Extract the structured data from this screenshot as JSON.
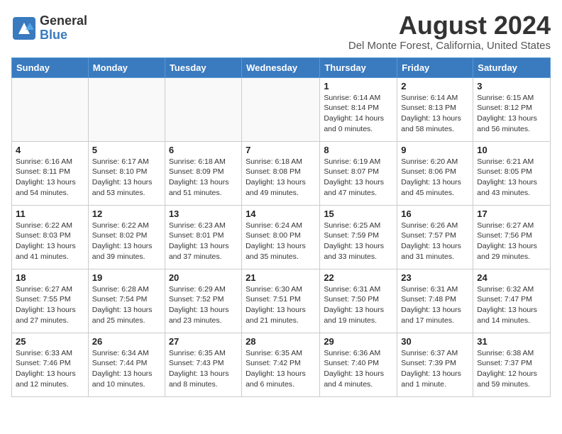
{
  "header": {
    "logo_general": "General",
    "logo_blue": "Blue",
    "month_year": "August 2024",
    "location": "Del Monte Forest, California, United States"
  },
  "days_of_week": [
    "Sunday",
    "Monday",
    "Tuesday",
    "Wednesday",
    "Thursday",
    "Friday",
    "Saturday"
  ],
  "weeks": [
    [
      {
        "day": "",
        "info": ""
      },
      {
        "day": "",
        "info": ""
      },
      {
        "day": "",
        "info": ""
      },
      {
        "day": "",
        "info": ""
      },
      {
        "day": "1",
        "info": "Sunrise: 6:14 AM\nSunset: 8:14 PM\nDaylight: 14 hours\nand 0 minutes."
      },
      {
        "day": "2",
        "info": "Sunrise: 6:14 AM\nSunset: 8:13 PM\nDaylight: 13 hours\nand 58 minutes."
      },
      {
        "day": "3",
        "info": "Sunrise: 6:15 AM\nSunset: 8:12 PM\nDaylight: 13 hours\nand 56 minutes."
      }
    ],
    [
      {
        "day": "4",
        "info": "Sunrise: 6:16 AM\nSunset: 8:11 PM\nDaylight: 13 hours\nand 54 minutes."
      },
      {
        "day": "5",
        "info": "Sunrise: 6:17 AM\nSunset: 8:10 PM\nDaylight: 13 hours\nand 53 minutes."
      },
      {
        "day": "6",
        "info": "Sunrise: 6:18 AM\nSunset: 8:09 PM\nDaylight: 13 hours\nand 51 minutes."
      },
      {
        "day": "7",
        "info": "Sunrise: 6:18 AM\nSunset: 8:08 PM\nDaylight: 13 hours\nand 49 minutes."
      },
      {
        "day": "8",
        "info": "Sunrise: 6:19 AM\nSunset: 8:07 PM\nDaylight: 13 hours\nand 47 minutes."
      },
      {
        "day": "9",
        "info": "Sunrise: 6:20 AM\nSunset: 8:06 PM\nDaylight: 13 hours\nand 45 minutes."
      },
      {
        "day": "10",
        "info": "Sunrise: 6:21 AM\nSunset: 8:05 PM\nDaylight: 13 hours\nand 43 minutes."
      }
    ],
    [
      {
        "day": "11",
        "info": "Sunrise: 6:22 AM\nSunset: 8:03 PM\nDaylight: 13 hours\nand 41 minutes."
      },
      {
        "day": "12",
        "info": "Sunrise: 6:22 AM\nSunset: 8:02 PM\nDaylight: 13 hours\nand 39 minutes."
      },
      {
        "day": "13",
        "info": "Sunrise: 6:23 AM\nSunset: 8:01 PM\nDaylight: 13 hours\nand 37 minutes."
      },
      {
        "day": "14",
        "info": "Sunrise: 6:24 AM\nSunset: 8:00 PM\nDaylight: 13 hours\nand 35 minutes."
      },
      {
        "day": "15",
        "info": "Sunrise: 6:25 AM\nSunset: 7:59 PM\nDaylight: 13 hours\nand 33 minutes."
      },
      {
        "day": "16",
        "info": "Sunrise: 6:26 AM\nSunset: 7:57 PM\nDaylight: 13 hours\nand 31 minutes."
      },
      {
        "day": "17",
        "info": "Sunrise: 6:27 AM\nSunset: 7:56 PM\nDaylight: 13 hours\nand 29 minutes."
      }
    ],
    [
      {
        "day": "18",
        "info": "Sunrise: 6:27 AM\nSunset: 7:55 PM\nDaylight: 13 hours\nand 27 minutes."
      },
      {
        "day": "19",
        "info": "Sunrise: 6:28 AM\nSunset: 7:54 PM\nDaylight: 13 hours\nand 25 minutes."
      },
      {
        "day": "20",
        "info": "Sunrise: 6:29 AM\nSunset: 7:52 PM\nDaylight: 13 hours\nand 23 minutes."
      },
      {
        "day": "21",
        "info": "Sunrise: 6:30 AM\nSunset: 7:51 PM\nDaylight: 13 hours\nand 21 minutes."
      },
      {
        "day": "22",
        "info": "Sunrise: 6:31 AM\nSunset: 7:50 PM\nDaylight: 13 hours\nand 19 minutes."
      },
      {
        "day": "23",
        "info": "Sunrise: 6:31 AM\nSunset: 7:48 PM\nDaylight: 13 hours\nand 17 minutes."
      },
      {
        "day": "24",
        "info": "Sunrise: 6:32 AM\nSunset: 7:47 PM\nDaylight: 13 hours\nand 14 minutes."
      }
    ],
    [
      {
        "day": "25",
        "info": "Sunrise: 6:33 AM\nSunset: 7:46 PM\nDaylight: 13 hours\nand 12 minutes."
      },
      {
        "day": "26",
        "info": "Sunrise: 6:34 AM\nSunset: 7:44 PM\nDaylight: 13 hours\nand 10 minutes."
      },
      {
        "day": "27",
        "info": "Sunrise: 6:35 AM\nSunset: 7:43 PM\nDaylight: 13 hours\nand 8 minutes."
      },
      {
        "day": "28",
        "info": "Sunrise: 6:35 AM\nSunset: 7:42 PM\nDaylight: 13 hours\nand 6 minutes."
      },
      {
        "day": "29",
        "info": "Sunrise: 6:36 AM\nSunset: 7:40 PM\nDaylight: 13 hours\nand 4 minutes."
      },
      {
        "day": "30",
        "info": "Sunrise: 6:37 AM\nSunset: 7:39 PM\nDaylight: 13 hours\nand 1 minute."
      },
      {
        "day": "31",
        "info": "Sunrise: 6:38 AM\nSunset: 7:37 PM\nDaylight: 12 hours\nand 59 minutes."
      }
    ]
  ]
}
